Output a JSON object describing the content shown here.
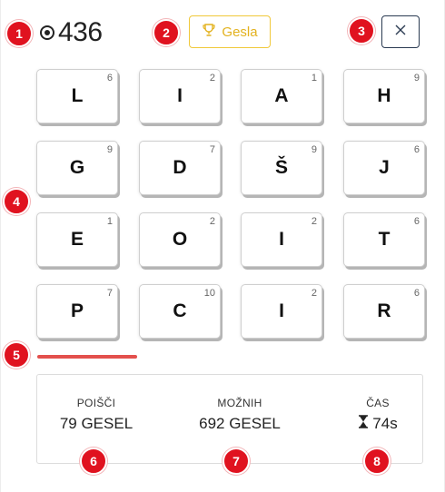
{
  "header": {
    "score_icon": "target-icon",
    "score": "436",
    "words_button": {
      "icon": "trophy-icon",
      "label": "Gesla",
      "color": "#e3b21f"
    },
    "close_icon": "close-icon"
  },
  "grid": {
    "tiles": [
      {
        "letter": "L",
        "points": "6"
      },
      {
        "letter": "I",
        "points": "2"
      },
      {
        "letter": "A",
        "points": "1"
      },
      {
        "letter": "H",
        "points": "9"
      },
      {
        "letter": "G",
        "points": "9"
      },
      {
        "letter": "D",
        "points": "7"
      },
      {
        "letter": "Š",
        "points": "9"
      },
      {
        "letter": "J",
        "points": "6"
      },
      {
        "letter": "E",
        "points": "1"
      },
      {
        "letter": "O",
        "points": "2"
      },
      {
        "letter": "I",
        "points": "2"
      },
      {
        "letter": "T",
        "points": "6"
      },
      {
        "letter": "P",
        "points": "7"
      },
      {
        "letter": "C",
        "points": "10"
      },
      {
        "letter": "I",
        "points": "2"
      },
      {
        "letter": "R",
        "points": "6"
      }
    ]
  },
  "timer_bar": {
    "color": "#e3504d"
  },
  "stats": {
    "found": {
      "label": "POIŠČI",
      "value": "79 GESEL"
    },
    "possible": {
      "label": "MOŽNIH",
      "value": "692 GESEL"
    },
    "time": {
      "label": "ČAS",
      "icon": "hourglass-icon",
      "value": "74s"
    }
  },
  "callouts": [
    "1",
    "2",
    "3",
    "4",
    "5",
    "6",
    "7",
    "8"
  ],
  "callout_color": "#e0121f"
}
